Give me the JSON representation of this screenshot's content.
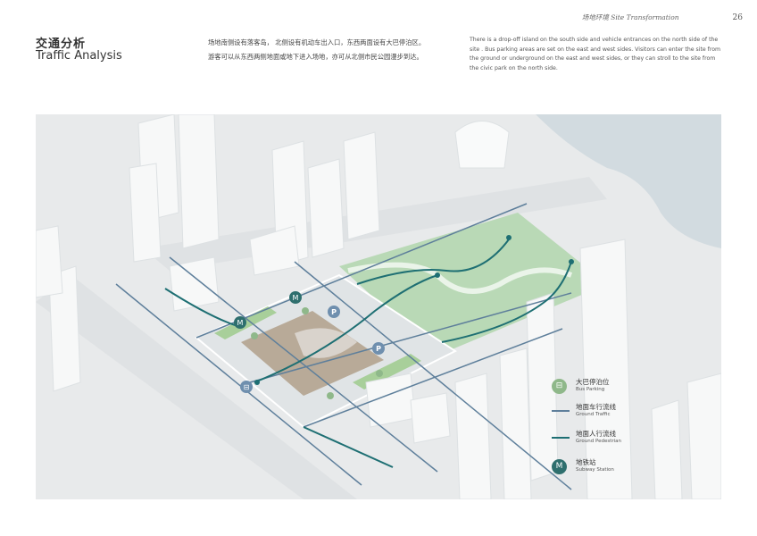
{
  "header": {
    "section_title": "场地环境  Site Transformation",
    "page_number": "26"
  },
  "title": {
    "cn": "交通分析",
    "en": "Traffic Analysis"
  },
  "description": {
    "cn_line1": "场地南侧设有落客岛， 北侧设有机动车出入口，东西两面设有大巴停泊区。",
    "cn_line2": "游客可以从东西两侧地面或地下进入场地，亦可从北侧市民公园漫步到达。",
    "en": "There is a drop-off island on the south side and vehicle entrances on the north side of the site . Bus parking areas are set on the east and west sides. Visitors can enter the site from the ground or underground on the east and west sides, or they can stroll to the site from the civic park on the north side."
  },
  "legend": [
    {
      "icon": "bus-icon",
      "glyph": "⊟",
      "cn": "大巴停泊位",
      "en": "Bus Parking"
    },
    {
      "icon": "ground-traffic-line",
      "glyph": "",
      "cn": "地面车行流线",
      "en": "Ground Traffic"
    },
    {
      "icon": "ground-pedestrian-line",
      "glyph": "",
      "cn": "地面人行流线",
      "en": "Ground Pedestrian"
    },
    {
      "icon": "subway-icon",
      "glyph": "M",
      "cn": "地铁站",
      "en": "Subway Station"
    }
  ],
  "map_labels": {
    "parking": "P",
    "subway": "M",
    "bus": "⊟"
  },
  "colors": {
    "traffic": "#5e7f9b",
    "pedestrian": "#1e6f73",
    "subway": "#2e6f6e",
    "bus": "#8fb88a",
    "park": "#b9d9b6",
    "parking": "#6f8fae"
  }
}
